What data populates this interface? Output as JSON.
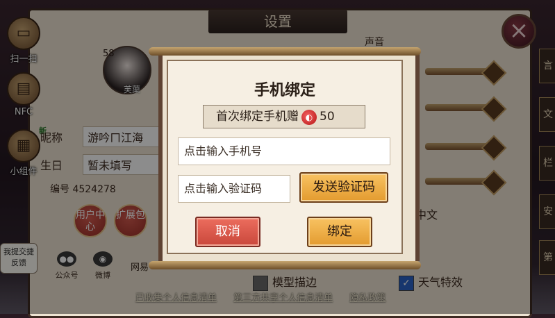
{
  "left_tools": [
    {
      "label": "扫一扫",
      "icon": "scan-icon"
    },
    {
      "label": "NFC",
      "icon": "nfc-icon"
    },
    {
      "label": "小组件",
      "icon": "widget-icon"
    }
  ],
  "settings": {
    "title": "设置",
    "close_icon": "close-icon",
    "right_section_title": "声音",
    "language": "中文",
    "checkbox_outline": "模型描边",
    "checkbox_weather": "天气特效"
  },
  "profile": {
    "level": "58",
    "avatar_name": "芙蕖",
    "new_badge": "新",
    "nickname_label": "昵称",
    "nickname_value": "游吟ㄇ江海",
    "birthday_label": "生日",
    "birthday_value": "暂未填写",
    "uid_label": "编号",
    "uid_value": "4524278",
    "user_center_btn": "用户中心",
    "expansion_btn": "扩展包",
    "social_wechat": "公众号",
    "social_weibo": "微博",
    "netease": "网易"
  },
  "feedback": "我提交捷反馈",
  "footer": {
    "collected_info": "已收集个人信息清单",
    "third_party_info": "第三方共享个人信息清单",
    "privacy_policy": "隐私政策"
  },
  "modal": {
    "title": "手机绑定",
    "reward_text": "首次绑定手机赠",
    "reward_icon": "magatama-icon",
    "reward_amount": "50",
    "phone_placeholder": "点击输入手机号",
    "code_placeholder": "点击输入验证码",
    "send_code_label": "发送验证码",
    "cancel_label": "取消",
    "bind_label": "绑定"
  },
  "colors": {
    "accent_orange": "#e39b2f",
    "cancel_red": "#c9473b",
    "parchment": "#f6efe3"
  }
}
